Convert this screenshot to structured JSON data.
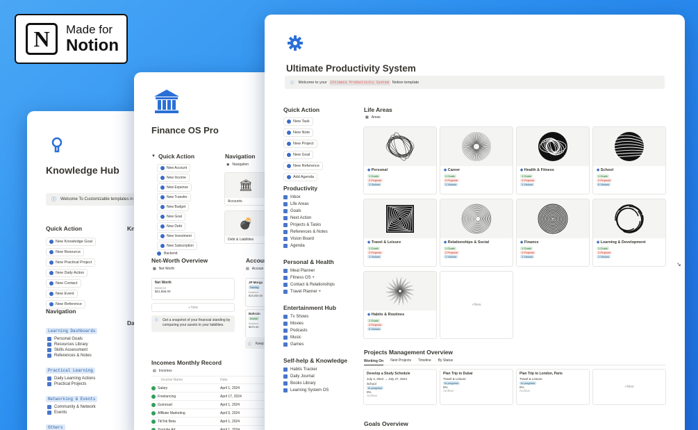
{
  "badge": {
    "line1": "Made for",
    "line2": "Notion"
  },
  "knowledge_hub": {
    "title": "Knowledge Hub",
    "callout": "Welcome To Customizable templates in No",
    "quick_action_heading": "Quick Action",
    "quick_actions": [
      "New Knowledge Goal",
      "New Resource",
      "New Practical Project",
      "New Daily Action",
      "New Contact",
      "New Event",
      "New Reference"
    ],
    "navigation_heading": "Navigation",
    "groups": [
      {
        "tag": "Learning Dashboards",
        "items": [
          "Personal Goals",
          "Resources Library",
          "Skills Assessment",
          "References & Notes"
        ]
      },
      {
        "tag": "Practical Learning",
        "items": [
          "Daily Learning Actions",
          "Practical Projects"
        ]
      },
      {
        "tag": "Networking & Events",
        "items": [
          "Community & Network",
          "Events"
        ]
      },
      {
        "tag": "Others",
        "items": []
      }
    ],
    "peek": {
      "kn": "Kn",
      "da": "Da"
    }
  },
  "finance_os": {
    "title": "Finance OS Pro",
    "quick_action_heading": "Quick Action",
    "quick_actions": [
      "New Account",
      "New Income",
      "New Expense",
      "New Transfer",
      "New Budget",
      "New Goal",
      "New Debt",
      "New Investment",
      "New Subscription",
      "Backend"
    ],
    "navigation_heading": "Navigation",
    "navigation_sub": "Navigation",
    "nav_cards": [
      "Accounts",
      "Debt & Liabilities"
    ],
    "net_worth_heading": "Net-Worth Overview",
    "net_worth_sub": "Net Worth",
    "net_worth_card": {
      "title": "Net Worth",
      "label": "Balance",
      "value": "$21,556.00"
    },
    "new_label": "New",
    "net_worth_callout": "Get a snapshot of your financial standing by comparing your assets to your liabilities.",
    "accounts_heading": "Accoun",
    "accounts_sub": "Accoun",
    "account_cards": [
      {
        "title": "JP Morga",
        "tag": "Saving",
        "label": "Balance",
        "value": "$15,000.00"
      },
      {
        "title": "Bahrain",
        "tag": "Invest",
        "label": "Balance",
        "value": "$570.00"
      }
    ],
    "keep_label": "Keep",
    "incomes_heading": "Incomes Monthly Record",
    "incomes_sub": "Incomes",
    "incomes_columns": [
      "Income Name",
      "Date"
    ],
    "incomes_rows": [
      {
        "name": "Salary",
        "date": "April 1, 2024"
      },
      {
        "name": "Freelancing",
        "date": "April 17, 2024"
      },
      {
        "name": "Gumroad",
        "date": "April 1, 2024"
      },
      {
        "name": "Affiliate Marketing",
        "date": "April 5, 2024"
      },
      {
        "name": "TikTok Beta",
        "date": "April 1, 2024"
      },
      {
        "name": "Youtube Ad",
        "date": "April 1, 2024"
      }
    ]
  },
  "ups": {
    "title": "Ultimate Productivity System",
    "callout_pre": "Welcome to your",
    "callout_code": "Ultimate Productivity System",
    "callout_post": "Notion template",
    "quick_action_heading": "Quick Action",
    "quick_actions": [
      "New Task",
      "New Note",
      "New Project",
      "New Goal",
      "New Reference",
      "Add Agenda"
    ],
    "sections": [
      {
        "heading": "Productivity",
        "items": [
          "Inbox",
          "Life Areas",
          "Goals",
          "Next Action",
          "Projects & Tasks",
          "References & Notes",
          "Vision Board",
          "Agenda"
        ]
      },
      {
        "heading": "Personal & Health",
        "items": [
          "Meal Planner",
          "Fitness OS +",
          "Contact & Relationships",
          "Travel Planner +"
        ]
      },
      {
        "heading": "Entertainment Hub",
        "items": [
          "Tv Shows",
          "Movies",
          "Podcasts",
          "Music",
          "Games"
        ]
      },
      {
        "heading": "Self-help & Knowledge",
        "items": [
          "Habits Tracker",
          "Daily Journal",
          "Books Library",
          "Learning System OS"
        ]
      }
    ],
    "life_areas_heading": "Life Areas",
    "areas_view": "Areas",
    "areas": [
      {
        "name": "Personal",
        "goals": "1 Goals",
        "projects": "2 Projects",
        "visions": "1 Visions"
      },
      {
        "name": "Career",
        "goals": "1 Goals",
        "projects": "2 Projects",
        "visions": "1 Visions"
      },
      {
        "name": "Health & Fitness",
        "goals": "1 Goals",
        "projects": "2 Projects",
        "visions": "1 Visions"
      },
      {
        "name": "School",
        "goals": "1 Goals",
        "projects": "2 Projects",
        "visions": "0 Visions"
      },
      {
        "name": "Travel & Leisure",
        "goals": "1 Goals",
        "projects": "2 Projects",
        "visions": "1 Visions"
      },
      {
        "name": "Relationships & Social",
        "goals": "1 Goals",
        "projects": "2 Projects",
        "visions": "1 Visions"
      },
      {
        "name": "Finance",
        "goals": "1 Goals",
        "projects": "2 Projects",
        "visions": "1 Visions"
      },
      {
        "name": "Learning & Development",
        "goals": "1 Goals",
        "projects": "2 Projects",
        "visions": "1 Visions"
      },
      {
        "name": "Habits & Routines",
        "goals": "1 Goals",
        "projects": "2 Projects",
        "visions": "0 Visions"
      }
    ],
    "new_label": "New",
    "projects_heading": "Projects Management Overview",
    "project_tabs": [
      "Working On",
      "Next Projects",
      "Timeline",
      "By Status"
    ],
    "projects": [
      {
        "title": "Develop a Study Schedule",
        "dates": "July 4, 2024 → July 27, 2024",
        "area": "School",
        "status": "In progress",
        "pct": "0%",
        "archive": "Archive"
      },
      {
        "title": "Plan Trip to Dubai",
        "dates": "",
        "area": "Travel & Leisure",
        "status": "In progress",
        "pct": "0%",
        "archive": "Archive"
      },
      {
        "title": "Plan Trip to London, Paris",
        "dates": "",
        "area": "Travel & Leisure",
        "status": "In progress",
        "pct": "0%",
        "archive": "Archive"
      }
    ],
    "goals_heading": "Goals Overview"
  }
}
